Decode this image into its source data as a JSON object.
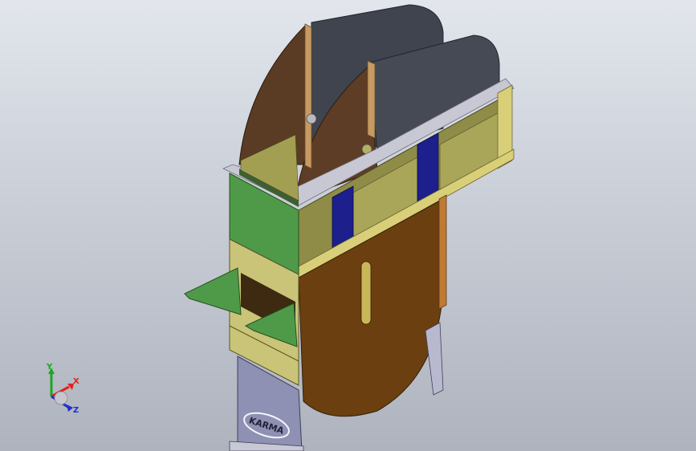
{
  "scene": {
    "background_top": "#e2e6ec",
    "background_bottom": "#aeb3bd",
    "model_name": "",
    "parts": {
      "hopper_fins": "#3f444f",
      "curved_side_plates": "#5a3b24",
      "lower_round_plate": "#6b3f0f",
      "upper_housing_side": "#8f8c47",
      "front_face": "#4f9a48",
      "inner_plates": "#d8cf78",
      "stiffener_bars": "#1c1f8c",
      "flange_strips": "#c79a62",
      "support_legs": "#8e90b4",
      "metal_trim": "#c8c8d4"
    }
  },
  "logo": {
    "text": "KARMA",
    "icon": "karma-logo"
  },
  "triad": {
    "x_label": "X",
    "y_label": "Y",
    "z_label": "Z",
    "x_color": "#e0231c",
    "y_color": "#19a81e",
    "z_color": "#1d2ed0"
  }
}
